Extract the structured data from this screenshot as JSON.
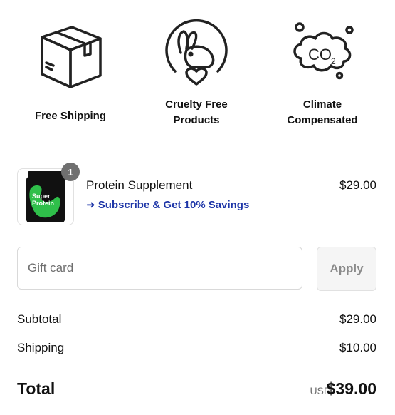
{
  "features": [
    {
      "icon": "package-box-icon",
      "label": "Free Shipping"
    },
    {
      "icon": "bunny-heart-icon",
      "label": "Cruelty Free Products"
    },
    {
      "icon": "co2-cloud-icon",
      "label": "Climate Compensated"
    }
  ],
  "cart": {
    "item": {
      "title": "Protein Supplement",
      "price": "$29.00",
      "quantity": "1",
      "subscribe_link": "➜ Subscribe & Get 10% Savings",
      "thumbnail_text": {
        "line1": "Super",
        "line2": "Protein"
      }
    }
  },
  "gift_card": {
    "placeholder": "Gift card",
    "value": "",
    "apply_label": "Apply"
  },
  "totals": {
    "subtotal_label": "Subtotal",
    "subtotal_value": "$29.00",
    "shipping_label": "Shipping",
    "shipping_value": "$10.00",
    "total_label": "Total",
    "currency": "USD",
    "total_value": "$39.00"
  },
  "colors": {
    "link": "#1e36a8",
    "badge": "#707070",
    "divider": "#dedede",
    "product_green": "#2fbf4a"
  }
}
